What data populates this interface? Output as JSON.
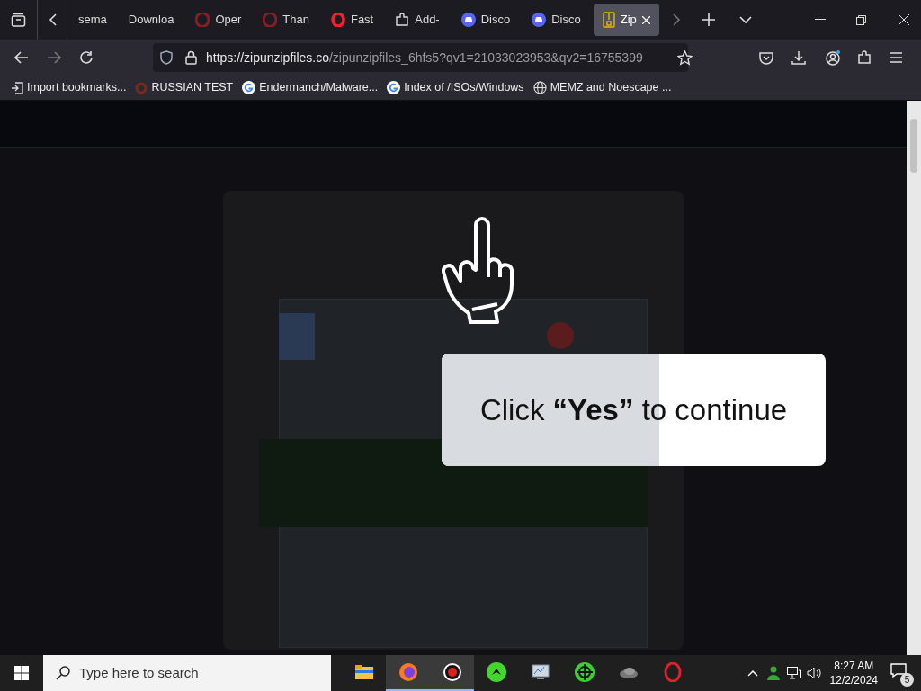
{
  "tabs": [
    {
      "label": "sema",
      "kind": "plain",
      "selected": false
    },
    {
      "label": "Downloa",
      "kind": "plain",
      "selected": false
    },
    {
      "label": "Oper",
      "kind": "opera-dim",
      "selected": false
    },
    {
      "label": "Than",
      "kind": "opera-dim",
      "selected": false
    },
    {
      "label": "Fast",
      "kind": "opera",
      "selected": false
    },
    {
      "label": "Add-",
      "kind": "addon",
      "selected": false
    },
    {
      "label": "Disco",
      "kind": "discord",
      "selected": false
    },
    {
      "label": "Disco",
      "kind": "discord",
      "selected": false
    },
    {
      "label": "Zip",
      "kind": "zip",
      "selected": true
    }
  ],
  "address": {
    "host": "https://zipunzipfiles.co",
    "path": "/zipunzipfiles_6hfs5?qv1=21033023953&qv2=16755399"
  },
  "bookmarks": [
    {
      "label": "Import bookmarks...",
      "kind": "import"
    },
    {
      "label": "RUSSIAN TEST",
      "kind": "ring"
    },
    {
      "label": "Endermanch/Malware...",
      "kind": "google"
    },
    {
      "label": "Index of /ISOs/Windows",
      "kind": "google"
    },
    {
      "label": "MEMZ and Noescape ...",
      "kind": "globe"
    }
  ],
  "prompt": {
    "text": "Click **“Yes”** to continue"
  },
  "taskbar": {
    "search_placeholder": "Type here to search",
    "time": "8:27 AM",
    "date": "12/2/2024",
    "notifications": "5",
    "apps": [
      {
        "kind": "folder",
        "active": false
      },
      {
        "kind": "firefox",
        "active": true
      },
      {
        "kind": "record",
        "active": true
      },
      {
        "kind": "razer",
        "active": false
      },
      {
        "kind": "monitor",
        "active": false
      },
      {
        "kind": "crosshair",
        "active": false
      },
      {
        "kind": "cloud",
        "active": false
      },
      {
        "kind": "opera",
        "active": false
      }
    ]
  }
}
